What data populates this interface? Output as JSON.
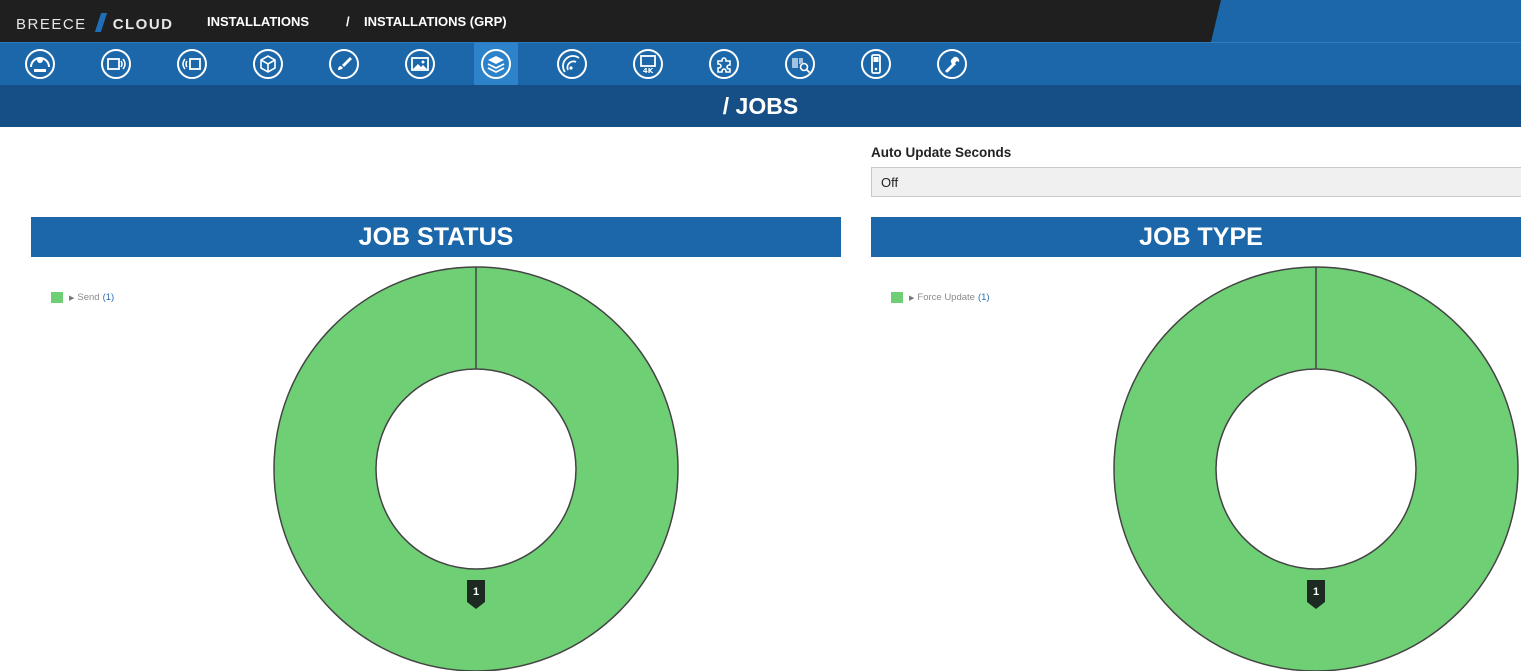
{
  "header": {
    "brand_left": "BREECE",
    "brand_right": "CLOUD",
    "breadcrumb_1": "INSTALLATIONS",
    "breadcrumb_2": "/    INSTALLATIONS (GRP)"
  },
  "toolbar": {
    "icons": [
      "dashboard-icon",
      "display-icon",
      "signal-icon",
      "box-icon",
      "paint-brush-icon",
      "images-icon",
      "layers-icon",
      "radar-icon",
      "4k-monitor-icon",
      "puzzle-icon",
      "barcode-search-icon",
      "phone-icon",
      "wrench-icon"
    ],
    "active_index": 6
  },
  "page": {
    "title": "/ JOBS"
  },
  "auto_update": {
    "label": "Auto Update Seconds",
    "value": "Off"
  },
  "colors": {
    "slice": "#6fcf75",
    "header_blue": "#1b67aa",
    "title_blue": "#154f85"
  },
  "chart_data": [
    {
      "type": "pie",
      "title": "JOB STATUS",
      "categories": [
        "Send"
      ],
      "values": [
        1
      ],
      "legend_labels": [
        "Send"
      ],
      "legend_counts": [
        "(1)"
      ],
      "data_label": "1",
      "legend_position": "top-left"
    },
    {
      "type": "pie",
      "title": "JOB TYPE",
      "categories": [
        "Force Update"
      ],
      "values": [
        1
      ],
      "legend_labels": [
        "Force Update"
      ],
      "legend_counts": [
        "(1)"
      ],
      "data_label": "1",
      "legend_position": "top-left"
    }
  ]
}
